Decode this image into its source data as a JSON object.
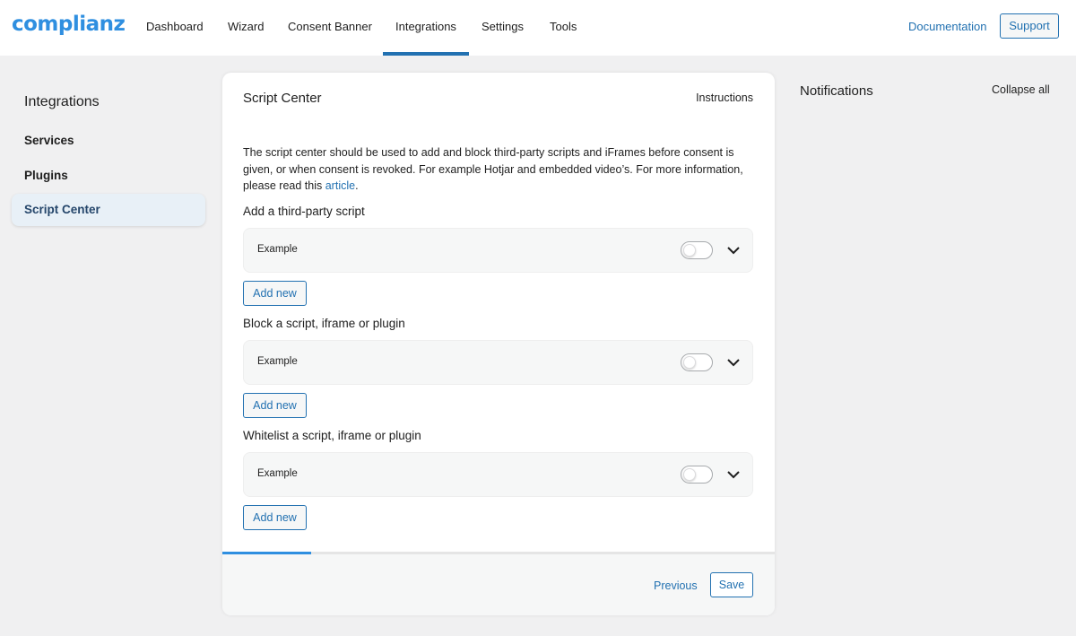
{
  "header": {
    "logo": "complianz",
    "nav": [
      "Dashboard",
      "Wizard",
      "Consent Banner",
      "Integrations",
      "Settings",
      "Tools"
    ],
    "active_nav": "Integrations",
    "documentation": "Documentation",
    "support": "Support"
  },
  "sidebar": {
    "title": "Integrations",
    "items": [
      {
        "label": "Services"
      },
      {
        "label": "Plugins"
      },
      {
        "label": "Script Center",
        "active": true
      }
    ]
  },
  "main": {
    "title": "Script Center",
    "instructions": "Instructions",
    "intro_text": "The script center should be used to add and block third-party scripts and iFrames before consent is given, or when consent is revoked. For example Hotjar and embedded video’s. For more information, please read this ",
    "intro_link": "article",
    "intro_end": ".",
    "sections": [
      {
        "label": "Add a third-party script",
        "panel_label": "Example",
        "enabled": false,
        "add_label": "Add new"
      },
      {
        "label": "Block a script, iframe or plugin",
        "panel_label": "Example",
        "enabled": false,
        "add_label": "Add new"
      },
      {
        "label": "Whitelist a script, iframe or plugin",
        "panel_label": "Example",
        "enabled": false,
        "add_label": "Add new"
      }
    ],
    "progress_percent": 16,
    "footer": {
      "previous": "Previous",
      "save": "Save"
    }
  },
  "notifications": {
    "title": "Notifications",
    "collapse_all": "Collapse all"
  },
  "colors": {
    "accent": "#2271b1",
    "logo": "#2f8fe0",
    "background": "#f0f0f1"
  }
}
